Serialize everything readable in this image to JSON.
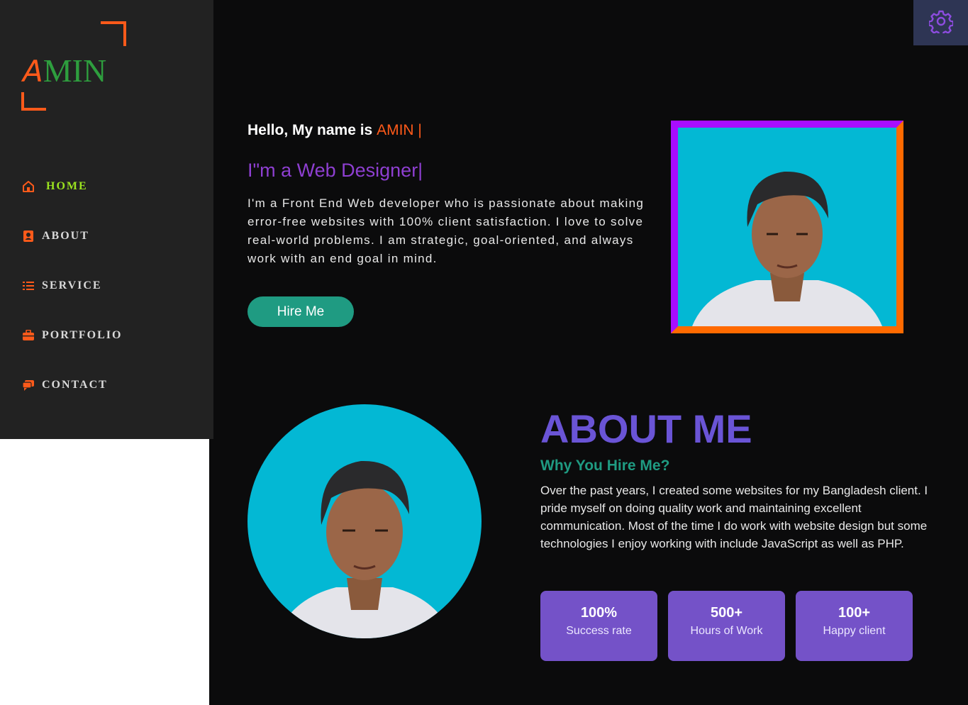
{
  "logo": {
    "first_letter": "A",
    "rest": "MIN"
  },
  "nav": {
    "items": [
      {
        "label": "HOME",
        "icon": "home-icon",
        "active": true
      },
      {
        "label": "ABOUT",
        "icon": "user-card-icon",
        "active": false
      },
      {
        "label": "SERVICE",
        "icon": "list-icon",
        "active": false
      },
      {
        "label": "PORTFOLIO",
        "icon": "briefcase-icon",
        "active": false
      },
      {
        "label": "CONTACT",
        "icon": "chat-icon",
        "active": false
      }
    ]
  },
  "settings": {
    "icon": "gear-icon"
  },
  "hero": {
    "hello_prefix": "Hello, My name is ",
    "hello_name": "AMIN |",
    "role": "I\"m a Web Designer|",
    "bio": "I'm a Front End Web developer who is passionate about making error-free websites with 100% client satisfaction. I love to solve real-world problems. I am strategic, goal-oriented, and always work with an end goal in mind.",
    "hire_label": "Hire Me"
  },
  "about": {
    "title": "ABOUT ME",
    "subtitle": "Why You Hire Me?",
    "text": "Over the past years, I created some websites for my Bangladesh client. I pride myself on doing quality work and maintaining excellent communication. Most of the time I do work with website design but some technologies I enjoy working with include JavaScript as well as PHP.",
    "stats": [
      {
        "value": "100%",
        "label": "Success rate"
      },
      {
        "value": "500+",
        "label": "Hours of Work"
      },
      {
        "value": "100+",
        "label": "Happy client"
      }
    ]
  },
  "colors": {
    "accent_orange": "#ff5a1a",
    "accent_green": "#9be31f",
    "teal": "#1f9b82",
    "purple": "#6a54d6",
    "photo_bg": "#03b8d4"
  }
}
